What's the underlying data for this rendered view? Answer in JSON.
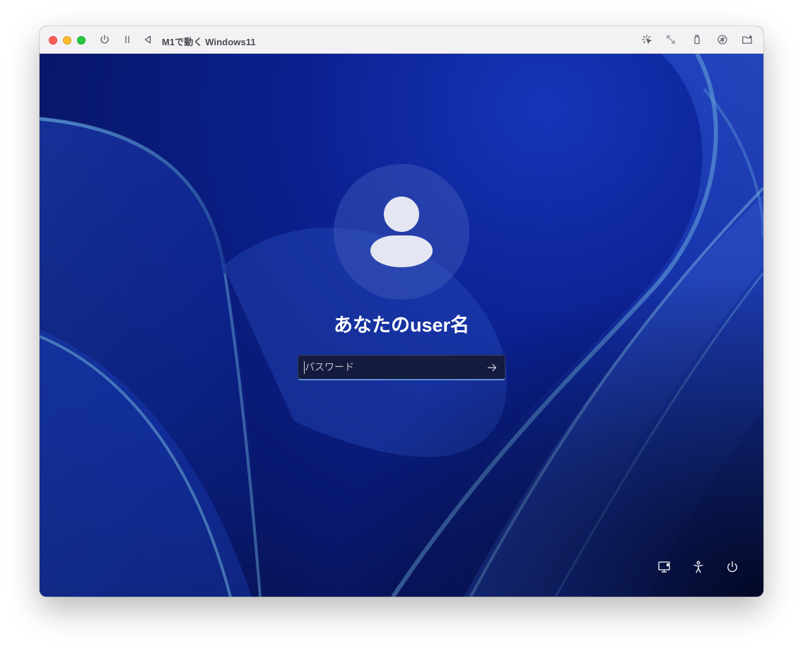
{
  "window": {
    "title": "M1で動く Windows11",
    "traffic_lights": {
      "close": "#ff5f57",
      "minimize": "#febc2e",
      "maximize": "#28c840"
    },
    "toolbar_left": [
      "power-icon",
      "pause-icon",
      "back-triangle-icon"
    ],
    "toolbar_right": [
      "sparkle-cursor-icon",
      "resize-arrows-icon",
      "usb-device-icon",
      "accessibility-circle-icon",
      "shared-folder-icon"
    ]
  },
  "login": {
    "username": "あなたのuser名",
    "password_placeholder": "パスワード",
    "password_value": "",
    "submit_icon": "arrow-right-icon"
  },
  "system_buttons": [
    "network-icon",
    "accessibility-icon",
    "power-icon"
  ],
  "colors": {
    "wallpaper_base": "#0b208f",
    "avatar_bg": "#4660be",
    "avatar_glyph": "#e4e7f1",
    "input_accent": "#5b8fd8"
  }
}
